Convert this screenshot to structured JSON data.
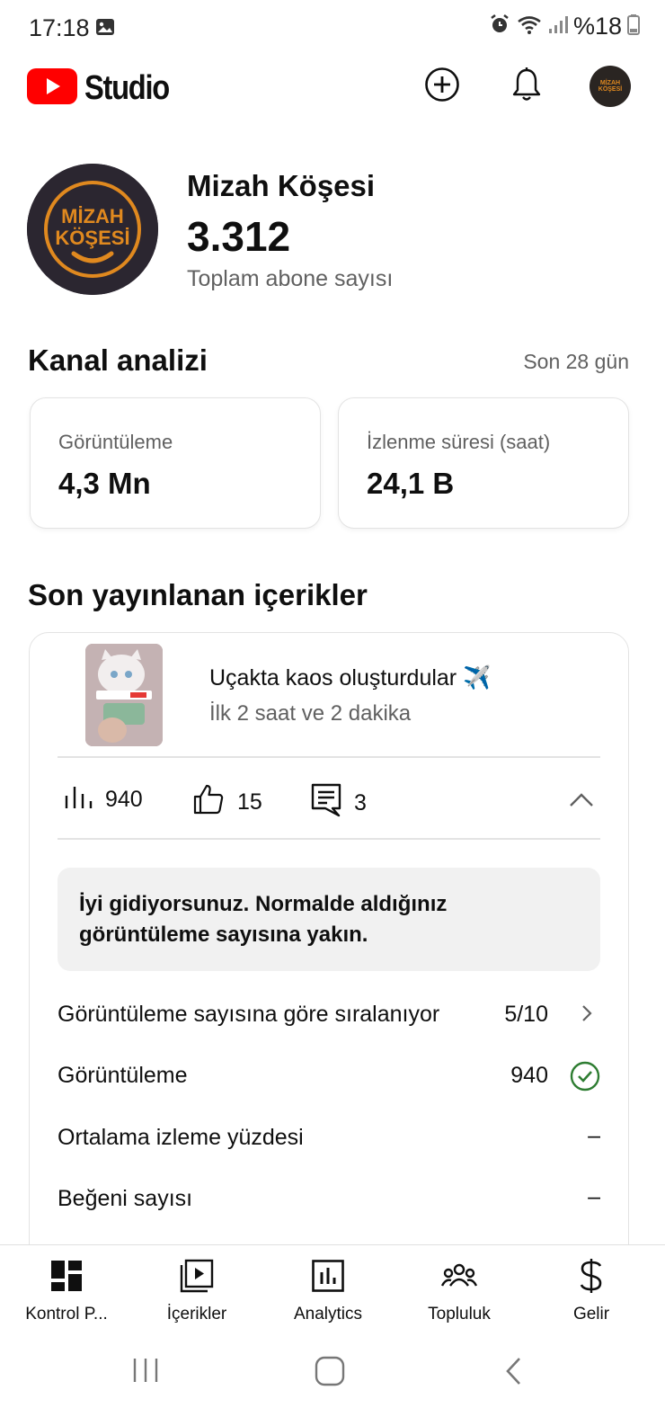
{
  "status_bar": {
    "time": "17:18",
    "battery": "%18",
    "icons": [
      "gallery-icon",
      "alarm-icon",
      "wifi-icon",
      "signal-icon",
      "battery-icon"
    ]
  },
  "header": {
    "app_name": "Studio",
    "create_icon": "add-circle-icon",
    "notifications_icon": "bell-icon",
    "avatar_text": "MİZAH KÖŞESİ"
  },
  "channel": {
    "name": "Mizah Köşesi",
    "subscribers": "3.312",
    "subscribers_label": "Toplam abone sayısı",
    "avatar_text_line1": "MİZAH",
    "avatar_text_line2": "KÖŞESİ"
  },
  "analytics": {
    "title": "Kanal analizi",
    "period": "Son 28 gün",
    "cards": [
      {
        "label": "Görüntüleme",
        "value": "4,3 Mn"
      },
      {
        "label": "İzlenme süresi (saat)",
        "value": "24,1 B"
      }
    ]
  },
  "recent": {
    "title": "Son yayınlanan içerikler",
    "video": {
      "title": "Uçakta kaos oluşturdular ✈️",
      "subtitle": "İlk 2 saat ve 2 dakika",
      "views": "940",
      "likes": "15",
      "comments": "3"
    },
    "tip": "İyi gidiyorsunuz. Normalde aldığınız görüntüleme sayısına yakın.",
    "rows": [
      {
        "label": "Görüntüleme sayısına göre sıralanıyor",
        "value": "5/10",
        "icon": "chevron-right-icon"
      },
      {
        "label": "Görüntüleme",
        "value": "940",
        "icon": "check-circle-icon"
      },
      {
        "label": "Ortalama izleme yüzdesi",
        "value": "–"
      },
      {
        "label": "Beğeni sayısı",
        "value": "–"
      }
    ]
  },
  "bottom_nav": [
    {
      "label": "Kontrol P...",
      "icon": "dashboard-icon"
    },
    {
      "label": "İçerikler",
      "icon": "content-icon"
    },
    {
      "label": "Analytics",
      "icon": "analytics-icon"
    },
    {
      "label": "Topluluk",
      "icon": "community-icon"
    },
    {
      "label": "Gelir",
      "icon": "dollar-icon"
    }
  ],
  "colors": {
    "youtube_red": "#ff0000",
    "accent_orange": "#e0891f",
    "success_green": "#2e7d32",
    "muted_text": "#606060"
  }
}
